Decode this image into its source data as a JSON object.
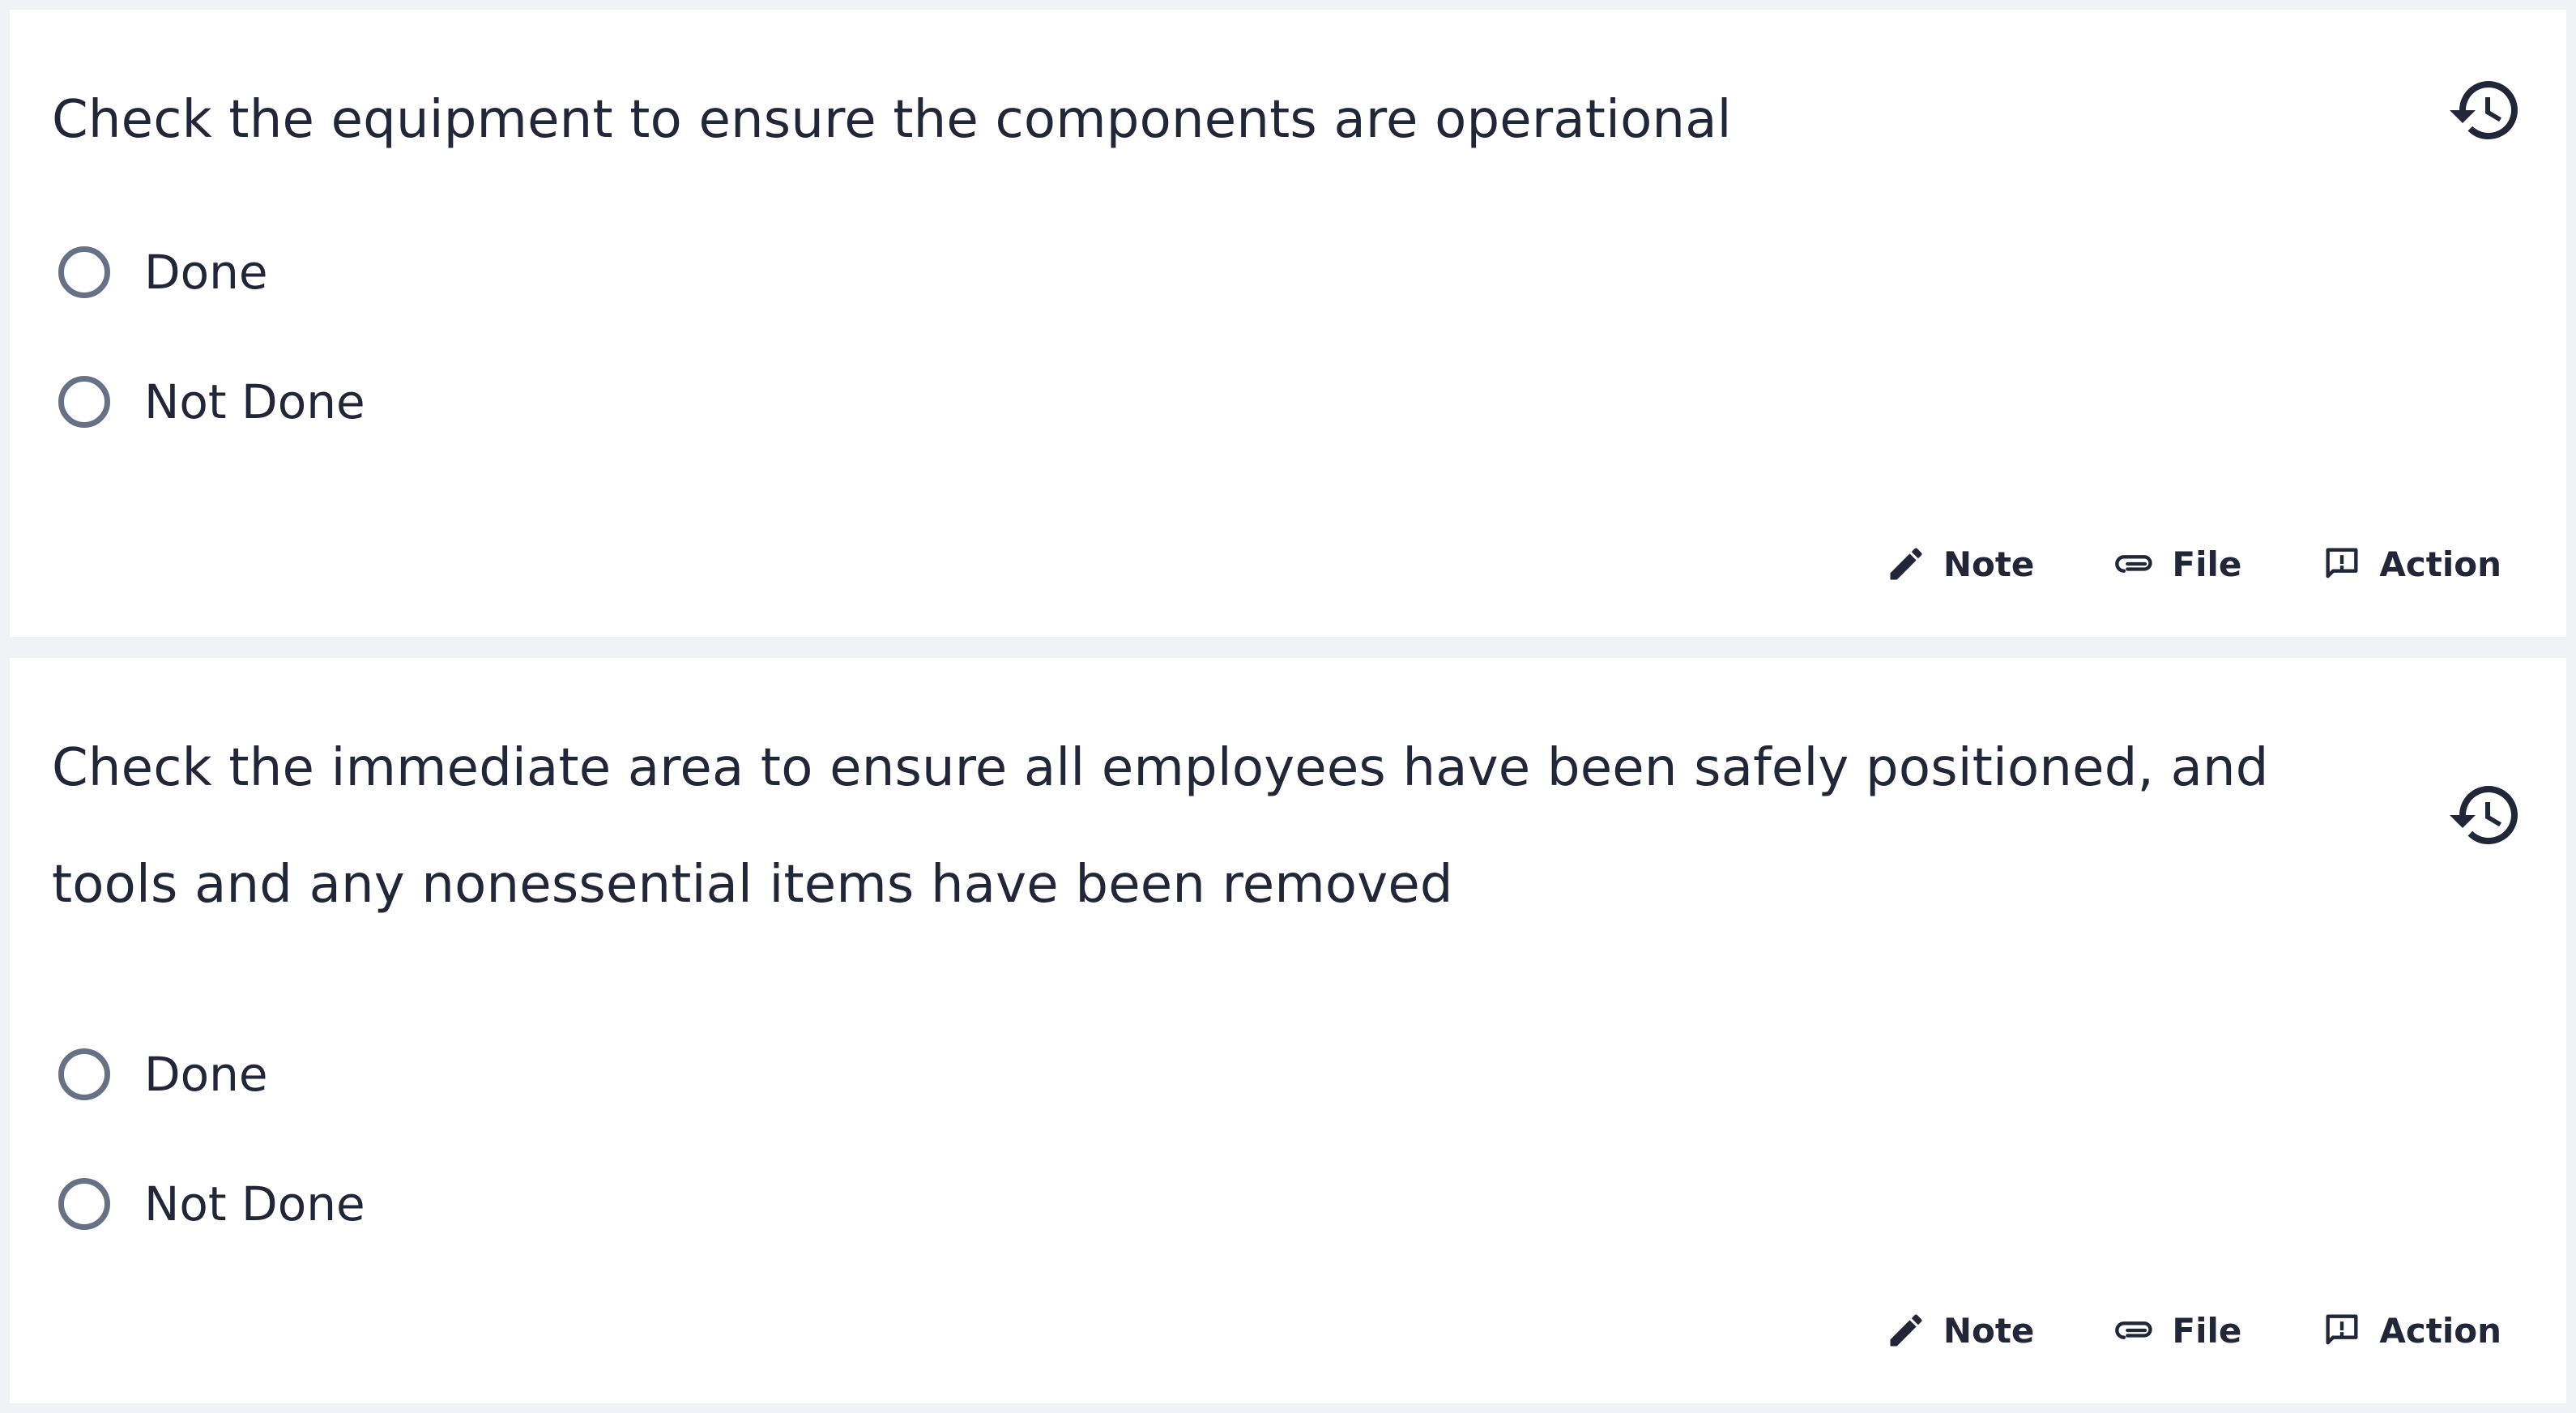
{
  "checklist": {
    "items": [
      {
        "question": "Check the equipment to ensure the components are operational",
        "history_icon": "history-icon",
        "options": [
          "Done",
          "Not Done"
        ],
        "actions": {
          "note": "Note",
          "file": "File",
          "action": "Action"
        }
      },
      {
        "question": "Check the immediate area to ensure all employees have been safely positioned, and tools and any nonessential items have been removed",
        "history_icon": "history-icon",
        "options": [
          "Done",
          "Not Done"
        ],
        "actions": {
          "note": "Note",
          "file": "File",
          "action": "Action"
        }
      }
    ]
  },
  "icons": {
    "note": "pencil-icon",
    "file": "paperclip-icon",
    "action": "feedback-icon",
    "history": "history-icon"
  },
  "colors": {
    "background": "#f0f2f6",
    "card": "#ffffff",
    "text": "#222639",
    "radio_border": "#677185"
  }
}
